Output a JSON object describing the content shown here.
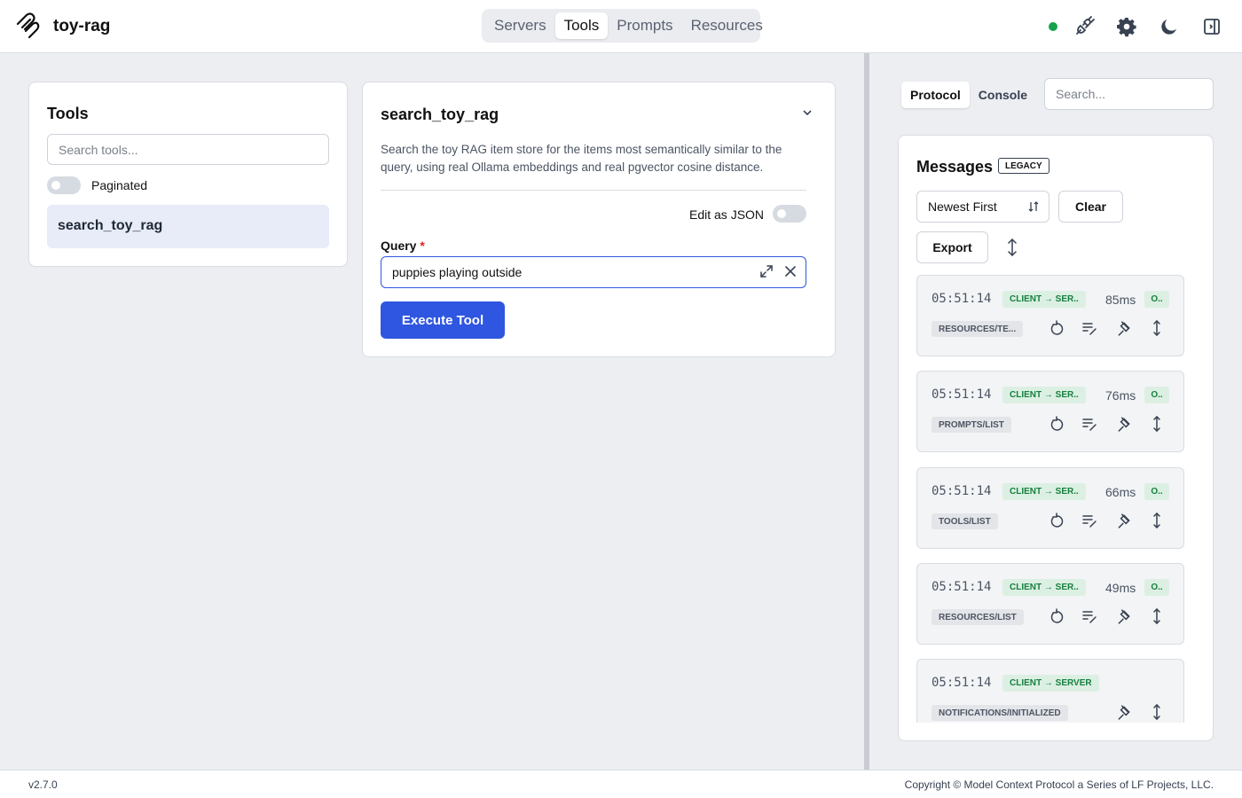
{
  "app": {
    "title": "toy-rag"
  },
  "nav": {
    "tabs": [
      "Servers",
      "Tools",
      "Prompts",
      "Resources"
    ],
    "active": "Tools"
  },
  "header_icons": [
    "status-dot",
    "plug-icon",
    "gear-icon",
    "moon-icon",
    "panel-toggle-icon"
  ],
  "tools_panel": {
    "title": "Tools",
    "search_placeholder": "Search tools...",
    "paginated_label": "Paginated",
    "items": [
      "search_toy_rag"
    ]
  },
  "tool_detail": {
    "name": "search_toy_rag",
    "description": "Search the toy RAG item store for the items most semantically similar to the query, using real Ollama embeddings and real pgvector cosine distance.",
    "edit_json_label": "Edit as JSON",
    "query_label": "Query",
    "required_mark": "*",
    "query_value": "puppies playing outside",
    "execute_label": "Execute Tool"
  },
  "right_panel": {
    "tabs": [
      "Protocol",
      "Console"
    ],
    "active_tab": "Protocol",
    "search_placeholder": "Search...",
    "messages_title": "Messages",
    "legacy_badge": "LEGACY",
    "sort_value": "Newest First",
    "clear_label": "Clear",
    "export_label": "Export",
    "messages": [
      {
        "time": "05:51:14",
        "direction": "CLIENT → SER..",
        "duration": "85ms",
        "status": "O..",
        "method": "RESOURCES/TE..."
      },
      {
        "time": "05:51:14",
        "direction": "CLIENT → SER..",
        "duration": "76ms",
        "status": "O..",
        "method": "PROMPTS/LIST"
      },
      {
        "time": "05:51:14",
        "direction": "CLIENT → SER..",
        "duration": "66ms",
        "status": "O..",
        "method": "TOOLS/LIST"
      },
      {
        "time": "05:51:14",
        "direction": "CLIENT → SER..",
        "duration": "49ms",
        "status": "O..",
        "method": "RESOURCES/LIST"
      },
      {
        "time": "05:51:14",
        "direction": "CLIENT → SERVER",
        "duration": "",
        "status": "",
        "method": "NOTIFICATIONS/INITIALIZED"
      }
    ]
  },
  "footer": {
    "version": "v2.7.0",
    "copyright": "Copyright © Model Context Protocol a Series of LF Projects, LLC."
  },
  "colors": {
    "accent": "#2f56e0",
    "success": "#16a34a",
    "badge_green_bg": "#dcefe3",
    "active_item_bg": "#e8ebf8"
  }
}
